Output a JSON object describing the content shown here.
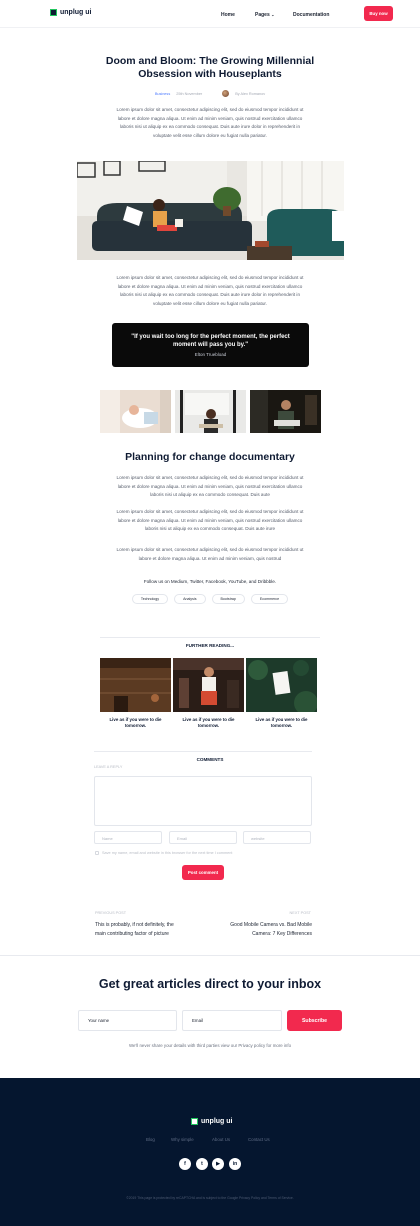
{
  "header": {
    "logo_text": "unplug ui",
    "nav": [
      "Home",
      "Pages",
      "Documentation"
    ],
    "pages_caret": "⌄",
    "buy_label": "Buy now"
  },
  "article": {
    "title": "Doom and Bloom: The Growing Millennial Obsession with Houseplants",
    "category": "Business",
    "date": "25th November",
    "author": "By Alex Romanov",
    "paragraph": "Lorem ipsum dolor sit amet, consectetur adipiscing elit, sed do eiusmod tempor incididunt ut labore et dolore magna aliqua. Ut enim ad minim veniam, quis nostrud exercitation ullamco laboris nisi ut aliquip ex ea commodo consequat. Duis aute irure dolor in reprehenderit in voluptate velit esse cillum dolore eu fugiat nulla pariatur.",
    "quote": "\"If you wait too long for the perfect moment, the perfect moment will pass you by.\"",
    "quote_author": "Elton Truebload",
    "h2": "Planning for change documentary",
    "p3": "Lorem ipsum dolor sit amet, consectetur adipiscing elit, sed do eiusmod tempor incididunt ut labore et dolore magna aliqua. Ut enim ad minim veniam, quis nostrud exercitation ullamco laboris nisi ut aliquip ex ea commodo consequat. Duis aute",
    "p4": "Lorem ipsum dolor sit amet, consectetur adipiscing elit, sed do eiusmod tempor incididunt ut labore et dolore magna aliqua. Ut enim ad minim veniam, quis nostrud exercitation ullamco laboris nisi ut aliquip ex ea commodo consequat. Duis aute irure",
    "p5": "Lorem ipsum dolor sit amet, consectetur adipiscing elit, sed do eiusmod tempor incididunt ut labore et dolore magna aliqua. Ut enim ad minim veniam, quis nostrud",
    "follow": "Follow us on Medium, Twitter, Facebook, YouTube, and Dribbble.",
    "tags": [
      "Technology",
      "Analysis",
      "Bootstrap",
      "Ecommerce"
    ]
  },
  "further": {
    "label": "FURTHER READING...",
    "cards": [
      {
        "title": "Live as if you were to die tomorrow."
      },
      {
        "title": "Live as if you were to die tomorrow."
      },
      {
        "title": "Live as if you were to die tomorrow."
      }
    ]
  },
  "comments": {
    "label": "COMMENTS",
    "leave": "LEAVE A REPLY",
    "name_ph": "Name",
    "email_ph": "Email",
    "website_ph": "website",
    "save_text": "Save my name, email and website in this browser for the next time I comment",
    "post_label": "Post comment"
  },
  "postnav": {
    "prev_label": "PREVIOUS POST",
    "prev_title": "This is probably, if not definitely, the main contributing factor of picture",
    "next_label": "NEXT POST",
    "next_title": "Good Mobile Camera vs. Bad Mobile Camera: 7 Key Differences"
  },
  "newsletter": {
    "title": "Get great articles direct to your inbox",
    "name_ph": "Your name",
    "email_ph": "Email",
    "subscribe": "Subscribe",
    "note": "We'll never share your details with third parties view our Privacy policy for more info"
  },
  "footer": {
    "logo_text": "unplug ui",
    "links": [
      "Blog",
      "Why simple",
      "About Us",
      "Contact Us"
    ],
    "social": [
      "f",
      "t",
      "▶",
      "in"
    ],
    "copyright": "©2019 This page is protected by reCAPTCHA and is subject to the Google Privacy Policy and Terms of Service."
  },
  "colors": {
    "accent": "#f2294e",
    "link": "#4f7cff",
    "footer_bg": "#05162f",
    "logo_green": "#22c55e"
  }
}
